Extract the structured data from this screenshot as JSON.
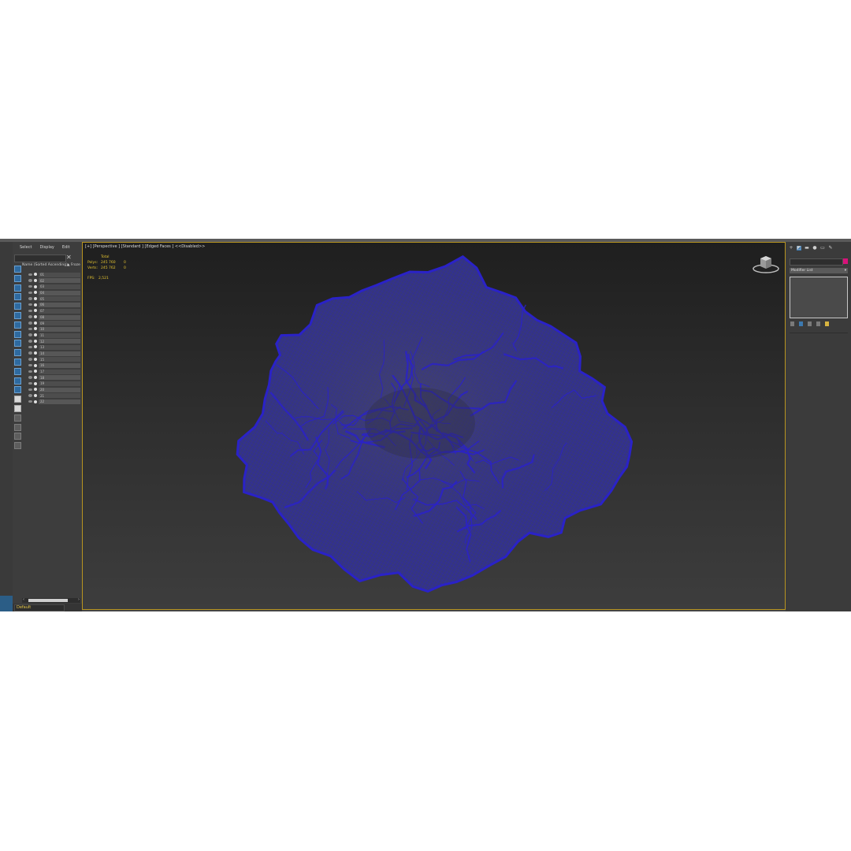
{
  "explorer": {
    "menu": [
      "Select",
      "Display",
      "Edit"
    ],
    "column_name": "Name (Sorted Ascending)",
    "column_frozen": "▲ Froze",
    "objects": [
      "01",
      "02",
      "03",
      "04",
      "05",
      "06",
      "07",
      "08",
      "09",
      "10",
      "11",
      "12",
      "13",
      "14",
      "15",
      "16",
      "17",
      "18",
      "19",
      "20",
      "21",
      "22"
    ],
    "layer": "Default"
  },
  "viewport": {
    "label": "[+] [Perspective ] [Standard ] [Edged Faces ]  <<Disabled>>",
    "stats": {
      "total_label": "Total",
      "polys_label": "Polys:",
      "polys_total": "245 760",
      "polys_sel": "0",
      "verts_label": "Verts:",
      "verts_total": "245 762",
      "verts_sel": "0",
      "fps_label": "FPS:",
      "fps_value": "2,521"
    },
    "wire_color": "#2a22c8"
  },
  "command_panel": {
    "tabs": [
      "+",
      "◩",
      "▬",
      "●",
      "▭",
      "✎"
    ],
    "modifier_list": "Modifier List",
    "object_color": "#d8127a"
  },
  "icons": [
    "close-icon",
    "eye-icon",
    "render-icon",
    "viewcube-icon",
    "scroll-left-icon",
    "scroll-right-icon",
    "dropdown-arrow-icon"
  ]
}
